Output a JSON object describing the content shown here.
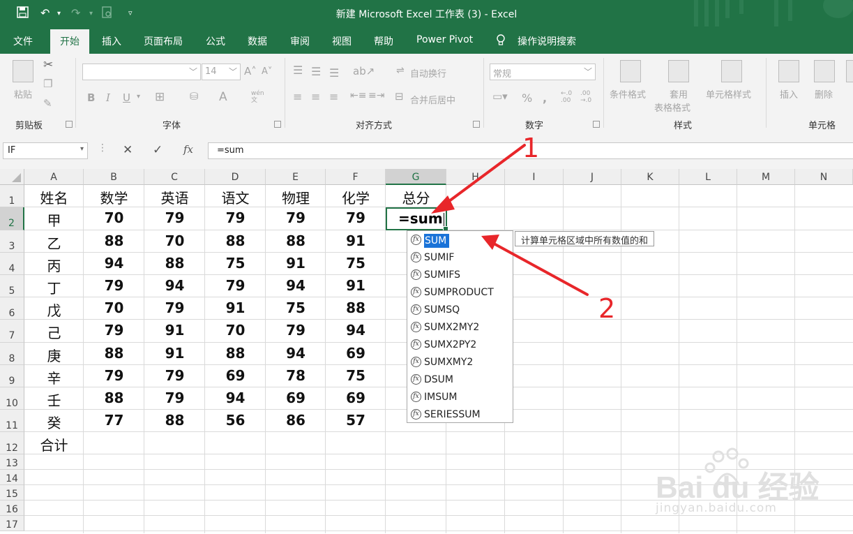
{
  "window": {
    "title": "新建 Microsoft Excel 工作表 (3)  -  Excel"
  },
  "tabs": [
    "文件",
    "开始",
    "插入",
    "页面布局",
    "公式",
    "数据",
    "审阅",
    "视图",
    "帮助",
    "Power Pivot",
    "操作说明搜索"
  ],
  "active_tab": "开始",
  "ribbon": {
    "clipboard": {
      "label": "剪贴板",
      "paste": "粘贴"
    },
    "font": {
      "label": "字体",
      "size": "14",
      "bold": "B",
      "italic": "I",
      "underline": "U",
      "wen": "wén\n文"
    },
    "alignment": {
      "label": "对齐方式",
      "wrap": "自动换行",
      "merge": "合并后居中"
    },
    "number": {
      "label": "数字",
      "format": "常规",
      "percent": "%"
    },
    "styles": {
      "label": "样式",
      "cond": "条件格式",
      "table1": "套用",
      "table2": "表格格式",
      "cellstyle": "单元格样式"
    },
    "cells": {
      "label": "单元格",
      "insert": "插入",
      "delete": "删除"
    }
  },
  "formula_bar": {
    "name_box": "IF",
    "cancel": "✕",
    "enter": "✓",
    "fx": "fx",
    "formula": "=sum"
  },
  "columns": [
    "A",
    "B",
    "C",
    "D",
    "E",
    "F",
    "G",
    "H",
    "I",
    "J",
    "K",
    "L",
    "M",
    "N"
  ],
  "selected_column": "G",
  "rows": [
    "1",
    "2",
    "3",
    "4",
    "5",
    "6",
    "7",
    "8",
    "9",
    "10",
    "11",
    "12",
    "13",
    "14",
    "15",
    "16",
    "17"
  ],
  "selected_row": "2",
  "table": {
    "headers": [
      "姓名",
      "数学",
      "英语",
      "语文",
      "物理",
      "化学",
      "总分"
    ],
    "data": [
      [
        "甲",
        "70",
        "79",
        "79",
        "79",
        "79"
      ],
      [
        "乙",
        "88",
        "70",
        "88",
        "88",
        "91"
      ],
      [
        "丙",
        "94",
        "88",
        "75",
        "91",
        "75"
      ],
      [
        "丁",
        "79",
        "94",
        "79",
        "94",
        "91"
      ],
      [
        "戊",
        "70",
        "79",
        "91",
        "75",
        "88"
      ],
      [
        "己",
        "79",
        "91",
        "70",
        "79",
        "94"
      ],
      [
        "庚",
        "88",
        "91",
        "88",
        "94",
        "69"
      ],
      [
        "辛",
        "79",
        "79",
        "69",
        "78",
        "75"
      ],
      [
        "壬",
        "88",
        "79",
        "94",
        "69",
        "69"
      ],
      [
        "癸",
        "77",
        "88",
        "56",
        "86",
        "57"
      ]
    ],
    "total_label": "合计"
  },
  "active_cell": {
    "ref": "G2",
    "value": "=sum"
  },
  "autocomplete": {
    "items": [
      "SUM",
      "SUMIF",
      "SUMIFS",
      "SUMPRODUCT",
      "SUMSQ",
      "SUMX2MY2",
      "SUMX2PY2",
      "SUMXMY2",
      "DSUM",
      "IMSUM",
      "SERIESSUM"
    ],
    "selected": "SUM",
    "tooltip": "计算单元格区域中所有数值的和"
  },
  "annotations": {
    "marker1": "1",
    "marker2": "2",
    "color": "#e8262a"
  },
  "watermark": {
    "logo": "Bai du 经验",
    "url": "jingyan.baidu.com"
  },
  "colors": {
    "accent": "#217346",
    "highlight": "#1a73d8"
  }
}
